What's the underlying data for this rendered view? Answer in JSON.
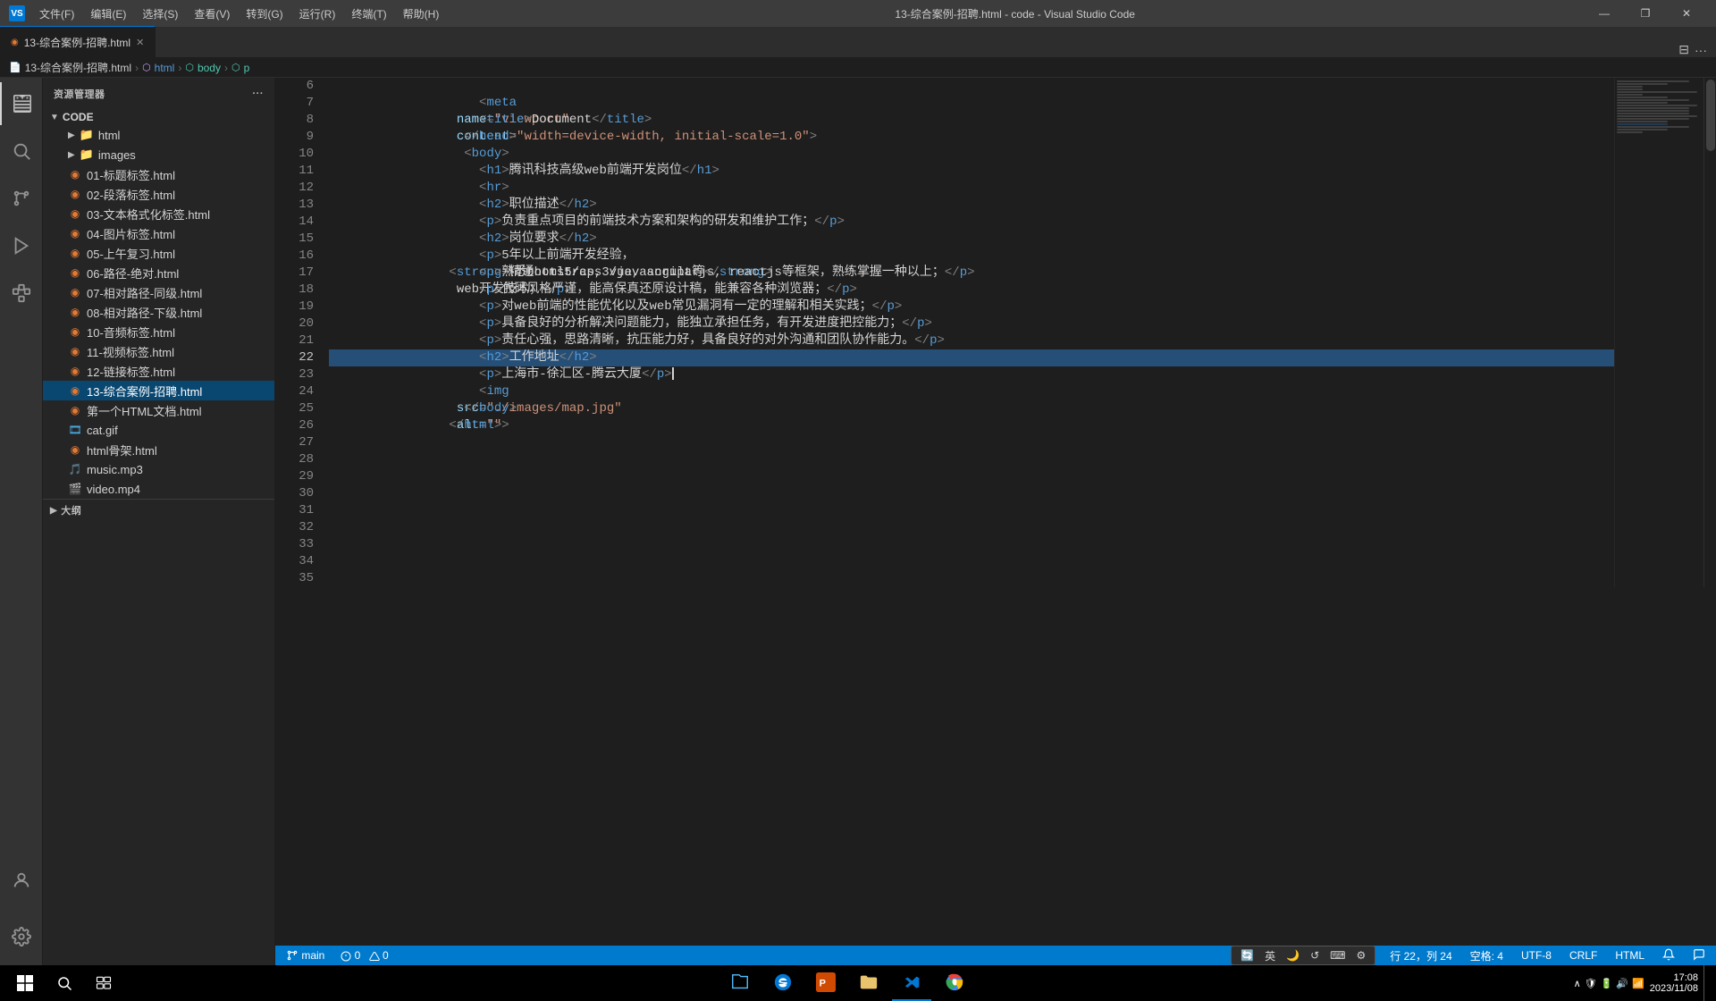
{
  "titleBar": {
    "vsIcon": "VS",
    "menus": [
      "文件(F)",
      "编辑(E)",
      "选择(S)",
      "查看(V)",
      "转到(G)",
      "运行(R)",
      "终端(T)",
      "帮助(H)"
    ],
    "title": "13-综合案例-招聘.html - code - Visual Studio Code",
    "controls": [
      "—",
      "❐",
      "✕"
    ]
  },
  "tabs": [
    {
      "label": "13-综合案例-招聘.html",
      "active": true,
      "icon": "◉"
    }
  ],
  "breadcrumb": {
    "file": "13-综合案例-招聘.html",
    "html": "html",
    "body": "body",
    "p": "p"
  },
  "sidebar": {
    "explorerTitle": "资源管理器",
    "moreIcon": "···",
    "rootFolder": "CODE",
    "folders": [
      {
        "name": "html",
        "type": "folder"
      },
      {
        "name": "images",
        "type": "folder"
      }
    ],
    "files": [
      {
        "name": "01-标题标签.html",
        "type": "html"
      },
      {
        "name": "02-段落标签.html",
        "type": "html"
      },
      {
        "name": "03-文本格式化标签.html",
        "type": "html"
      },
      {
        "name": "04-图片标签.html",
        "type": "html"
      },
      {
        "name": "05-上午复习.html",
        "type": "html"
      },
      {
        "name": "06-路径-绝对.html",
        "type": "html"
      },
      {
        "name": "07-相对路径-同级.html",
        "type": "html"
      },
      {
        "name": "08-相对路径-下级.html",
        "type": "html"
      },
      {
        "name": "10-音频标签.html",
        "type": "html"
      },
      {
        "name": "11-视频标签.html",
        "type": "html"
      },
      {
        "name": "12-链接标签.html",
        "type": "html"
      },
      {
        "name": "13-综合案例-招聘.html",
        "type": "html",
        "active": true
      },
      {
        "name": "第一个HTML文档.html",
        "type": "html"
      },
      {
        "name": "cat.gif",
        "type": "gif"
      },
      {
        "name": "html骨架.html",
        "type": "html"
      },
      {
        "name": "music.mp3",
        "type": "mp3"
      },
      {
        "name": "video.mp4",
        "type": "mp4"
      }
    ],
    "outlineLabel": "大纲"
  },
  "editor": {
    "lines": [
      {
        "num": 6,
        "content": "    <meta name=\"viewport\" content=\"width=device-width, initial-scale=1.0\">",
        "type": "code"
      },
      {
        "num": 7,
        "content": "    <title>Document</title>",
        "type": "code"
      },
      {
        "num": 8,
        "content": "  </head>",
        "type": "code"
      },
      {
        "num": 9,
        "content": "  <body>",
        "type": "code"
      },
      {
        "num": 10,
        "content": "    <h1>腾讯科技高级web前端开发岗位</h1>",
        "type": "code"
      },
      {
        "num": 11,
        "content": "    <hr>",
        "type": "code"
      },
      {
        "num": 12,
        "content": "    <h2>职位描述</h2>",
        "type": "code"
      },
      {
        "num": 13,
        "content": "    <p>负责重点项目的前端技术方案和架构的研发和维护工作；</p>",
        "type": "code"
      },
      {
        "num": 14,
        "content": "    <h2>岗位要求</h2>",
        "type": "code"
      },
      {
        "num": 15,
        "content": "    <p>5年以上前端开发经验，  <strong>精通html5/css3/javascript等</strong> web开发技术；</p>",
        "type": "code"
      },
      {
        "num": 16,
        "content": "    <p>熟悉bootstrap, vue, angularjs, reactjs等框架，熟练掌握一种以上；</p>",
        "type": "code"
      },
      {
        "num": 17,
        "content": "    <p>代码风格严谨，能高保真还原设计稿，能兼容各种浏览器；</p>",
        "type": "code"
      },
      {
        "num": 18,
        "content": "    <p>对web前端的性能优化以及web常见漏洞有一定的理解和相关实践；</p>",
        "type": "code"
      },
      {
        "num": 19,
        "content": "    <p>具备良好的分析解决问题能力，能独立承担任务，有开发进度把控能力；</p>",
        "type": "code"
      },
      {
        "num": 20,
        "content": "    <p>责任心强，思路清晰，抗压能力好，具备良好的对外沟通和团队协作能力。</p>",
        "type": "code"
      },
      {
        "num": 21,
        "content": "    <h2>工作地址</h2>",
        "type": "code"
      },
      {
        "num": 22,
        "content": "    <p>上海市-徐汇区-腾云大厦</p>",
        "type": "code",
        "current": true
      },
      {
        "num": 23,
        "content": "    <img src=\"./images/map.jpg\" alt=\"\">",
        "type": "code"
      },
      {
        "num": 24,
        "content": "  </body>",
        "type": "code"
      },
      {
        "num": 25,
        "content": "</html>",
        "type": "code"
      },
      {
        "num": 26,
        "content": "",
        "type": "empty"
      },
      {
        "num": 27,
        "content": "",
        "type": "empty"
      },
      {
        "num": 28,
        "content": "",
        "type": "empty"
      },
      {
        "num": 29,
        "content": "",
        "type": "empty"
      },
      {
        "num": 30,
        "content": "",
        "type": "empty"
      },
      {
        "num": 31,
        "content": "",
        "type": "empty"
      },
      {
        "num": 32,
        "content": "",
        "type": "empty"
      },
      {
        "num": 33,
        "content": "",
        "type": "empty"
      },
      {
        "num": 34,
        "content": "",
        "type": "empty"
      },
      {
        "num": 35,
        "content": "",
        "type": "empty"
      }
    ]
  },
  "statusBar": {
    "left": {
      "branch": "⎇ main"
    },
    "right": {
      "position": "行 22，列 24",
      "spaces": "空格: 4",
      "encoding": "UTF-8",
      "lineEnding": "CRLF",
      "language": "HTML"
    }
  },
  "inputMethod": {
    "label": "英",
    "items": [
      "英",
      "🌙",
      "⟳",
      "⌨",
      "⚙"
    ]
  },
  "taskbar": {
    "apps": [
      {
        "name": "start",
        "icon": "⊞"
      },
      {
        "name": "search",
        "icon": "🔍"
      },
      {
        "name": "files",
        "icon": "📁"
      },
      {
        "name": "edge",
        "icon": "🌐"
      },
      {
        "name": "powerpoint",
        "icon": "📊"
      },
      {
        "name": "explorer",
        "icon": "📂"
      },
      {
        "name": "vscode",
        "icon": "{ }",
        "active": true
      },
      {
        "name": "chrome",
        "icon": "🔵"
      }
    ],
    "clock": "17:08",
    "date": "2023/11/08"
  }
}
